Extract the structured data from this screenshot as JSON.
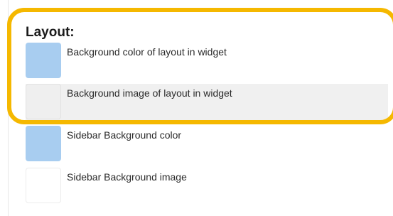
{
  "layout_section": {
    "title": "Layout:",
    "settings": [
      {
        "label": "Background color of layout in widget",
        "kind": "color",
        "value": "#a8cdf0"
      },
      {
        "label": "Background image of layout in widget",
        "kind": "image"
      },
      {
        "label": "Sidebar Background color",
        "kind": "color",
        "value": "#a8cdf0"
      },
      {
        "label": "Sidebar Background image",
        "kind": "image"
      }
    ]
  },
  "highlight": {
    "color": "#f5b800"
  }
}
